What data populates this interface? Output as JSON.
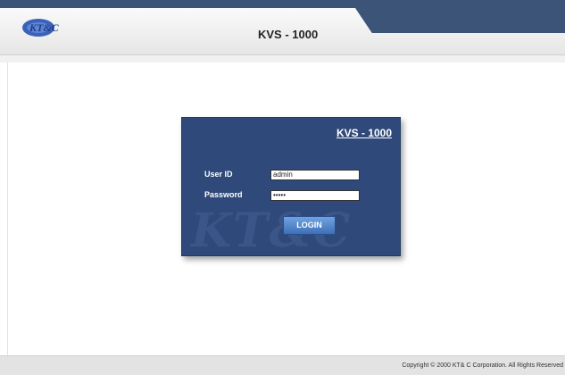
{
  "header": {
    "logo_text": "KT&C",
    "title": "KVS - 1000"
  },
  "login": {
    "panel_title": "KVS - 1000",
    "watermark": "KT&C",
    "user_id_label": "User ID",
    "user_id_value": "admin",
    "password_label": "Password",
    "password_value": "•••••",
    "login_button": "LOGIN"
  },
  "footer": {
    "copyright": "Copyright © 2000 KT& C Corporation. All Rights Reserved"
  },
  "colors": {
    "brand_navy": "#3b5478",
    "panel_blue": "#2f4a7a",
    "button_blue": "#4f82cc"
  }
}
